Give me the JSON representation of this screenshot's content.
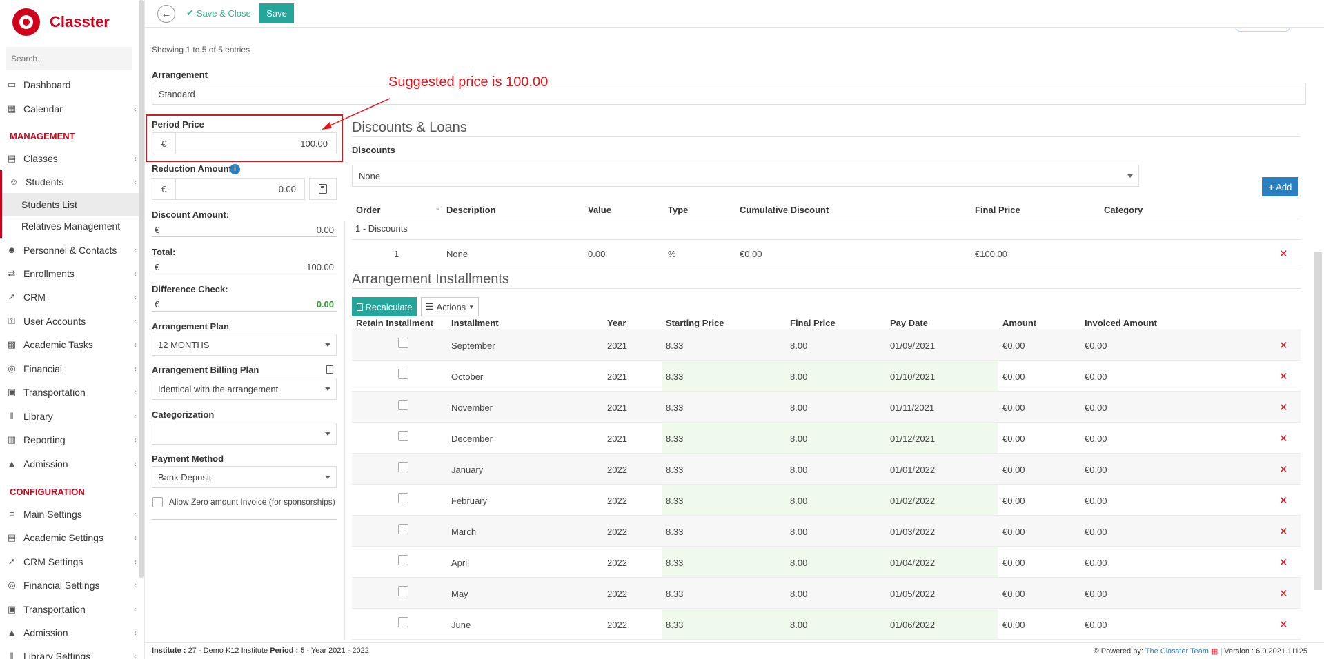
{
  "app": {
    "name": "Classter"
  },
  "sidebar": {
    "search_placeholder": "Search...",
    "items": [
      {
        "label": "Dashboard",
        "icon": "laptop-icon",
        "chev": false
      },
      {
        "label": "Calendar",
        "icon": "calendar-icon",
        "chev": true
      }
    ],
    "management_title": "MANAGEMENT",
    "management": [
      {
        "label": "Classes",
        "icon": "classes-icon",
        "chev": true
      },
      {
        "label": "Students",
        "icon": "students-icon",
        "chev": true
      },
      {
        "label": "Students List"
      },
      {
        "label": "Relatives Management"
      },
      {
        "label": "Personnel & Contacts",
        "icon": "personnel-icon",
        "chev": true
      },
      {
        "label": "Enrollments",
        "icon": "enrollments-icon",
        "chev": true
      },
      {
        "label": "CRM",
        "icon": "crm-icon",
        "chev": true
      },
      {
        "label": "User Accounts",
        "icon": "key-icon",
        "chev": true
      },
      {
        "label": "Academic Tasks",
        "icon": "grid-icon",
        "chev": true
      },
      {
        "label": "Financial",
        "icon": "coins-icon",
        "chev": true
      },
      {
        "label": "Transportation",
        "icon": "bus-icon",
        "chev": true
      },
      {
        "label": "Library",
        "icon": "library-icon",
        "chev": true
      },
      {
        "label": "Reporting",
        "icon": "printer-icon",
        "chev": true
      },
      {
        "label": "Admission",
        "icon": "bank-icon",
        "chev": true
      }
    ],
    "configuration_title": "CONFIGURATION",
    "configuration": [
      {
        "label": "Main Settings",
        "icon": "sliders-icon",
        "chev": true
      },
      {
        "label": "Academic Settings",
        "icon": "classes-icon",
        "chev": true
      },
      {
        "label": "CRM Settings",
        "icon": "crm-icon",
        "chev": true
      },
      {
        "label": "Financial Settings",
        "icon": "coins-icon",
        "chev": true
      },
      {
        "label": "Transportation",
        "icon": "bus-icon",
        "chev": true
      },
      {
        "label": "Admission",
        "icon": "bank-icon",
        "chev": true
      },
      {
        "label": "Library Settings",
        "icon": "library-icon",
        "chev": true
      }
    ]
  },
  "toolbar": {
    "save_close": "Save & Close",
    "save": "Save"
  },
  "showing": "Showing 1 to 5 of 5 entries",
  "arrangement": {
    "label": "Arrangement",
    "value": "Standard"
  },
  "annotation": "Suggested price is 100.00",
  "left_form": {
    "period_price": {
      "label": "Period Price",
      "currency": "€",
      "value": "100.00"
    },
    "reduction": {
      "label": "Reduction Amount",
      "currency": "€",
      "value": "0.00"
    },
    "discount_amount": {
      "label": "Discount Amount:",
      "currency": "€",
      "value": "0.00"
    },
    "total": {
      "label": "Total:",
      "currency": "€",
      "value": "100.00"
    },
    "difference": {
      "label": "Difference Check:",
      "currency": "€",
      "value": "0.00"
    },
    "plan": {
      "label": "Arrangement Plan",
      "value": "12 MONTHS"
    },
    "billing_plan": {
      "label": "Arrangement Billing Plan",
      "value": "Identical with the arrangement"
    },
    "categorization": {
      "label": "Categorization",
      "value": ""
    },
    "payment": {
      "label": "Payment Method",
      "value": "Bank Deposit"
    },
    "allow_zero": "Allow Zero amount Invoice (for sponsorships)"
  },
  "discounts": {
    "title": "Discounts & Loans",
    "label": "Discounts",
    "select_value": "None",
    "add_label": "Add",
    "headers": [
      "Order",
      "Description",
      "Value",
      "Type",
      "Cumulative Discount",
      "Final Price",
      "Category"
    ],
    "group": "1 - Discounts",
    "rows": [
      {
        "order": "1",
        "description": "None",
        "value": "0.00",
        "type": "%",
        "cumulative": "€0.00",
        "final": "€100.00",
        "category": ""
      }
    ]
  },
  "installments": {
    "title": "Arrangement Installments",
    "recalculate": "Recalculate",
    "actions": "Actions",
    "headers": [
      "Retain Installment",
      "Installment",
      "Year",
      "Starting Price",
      "Final Price",
      "Pay Date",
      "Amount",
      "Invoiced Amount"
    ],
    "rows": [
      {
        "month": "September",
        "year": "2021",
        "start": "8.33",
        "final": "8.00",
        "date": "01/09/2021",
        "amount": "€0.00",
        "invoiced": "€0.00"
      },
      {
        "month": "October",
        "year": "2021",
        "start": "8.33",
        "final": "8.00",
        "date": "01/10/2021",
        "amount": "€0.00",
        "invoiced": "€0.00"
      },
      {
        "month": "November",
        "year": "2021",
        "start": "8.33",
        "final": "8.00",
        "date": "01/11/2021",
        "amount": "€0.00",
        "invoiced": "€0.00"
      },
      {
        "month": "December",
        "year": "2021",
        "start": "8.33",
        "final": "8.00",
        "date": "01/12/2021",
        "amount": "€0.00",
        "invoiced": "€0.00"
      },
      {
        "month": "January",
        "year": "2022",
        "start": "8.33",
        "final": "8.00",
        "date": "01/01/2022",
        "amount": "€0.00",
        "invoiced": "€0.00"
      },
      {
        "month": "February",
        "year": "2022",
        "start": "8.33",
        "final": "8.00",
        "date": "01/02/2022",
        "amount": "€0.00",
        "invoiced": "€0.00"
      },
      {
        "month": "March",
        "year": "2022",
        "start": "8.33",
        "final": "8.00",
        "date": "01/03/2022",
        "amount": "€0.00",
        "invoiced": "€0.00"
      },
      {
        "month": "April",
        "year": "2022",
        "start": "8.33",
        "final": "8.00",
        "date": "01/04/2022",
        "amount": "€0.00",
        "invoiced": "€0.00"
      },
      {
        "month": "May",
        "year": "2022",
        "start": "8.33",
        "final": "8.00",
        "date": "01/05/2022",
        "amount": "€0.00",
        "invoiced": "€0.00"
      },
      {
        "month": "June",
        "year": "2022",
        "start": "8.33",
        "final": "8.00",
        "date": "01/06/2022",
        "amount": "€0.00",
        "invoiced": "€0.00"
      }
    ]
  },
  "footer": {
    "institute_label": "Institute :",
    "institute": "27 - Demo K12 Institute",
    "period_label": "Period :",
    "period": "5 - Year 2021 - 2022",
    "powered": "Powered by:",
    "team": "The Classter Team",
    "version": "| Version : 6.0.2021.11125"
  },
  "colors": {
    "brand": "#d0021b",
    "green": "#26a69a",
    "blue": "#2a7fc0",
    "annotation": "#e0161d"
  }
}
